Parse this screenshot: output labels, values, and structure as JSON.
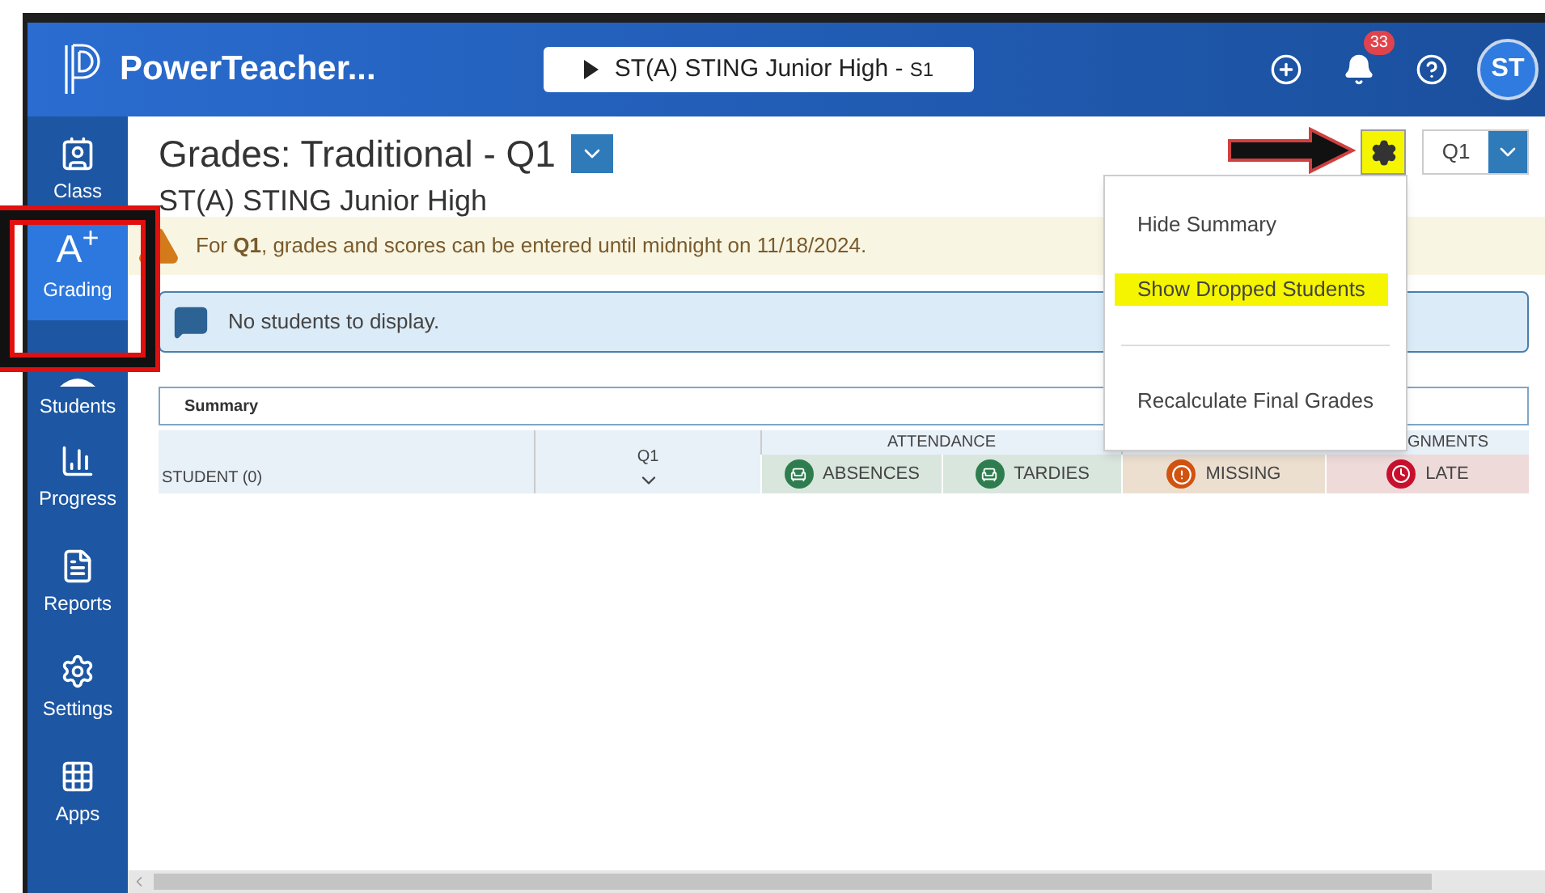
{
  "header": {
    "app_name": "PowerTeacher...",
    "class_selector": {
      "label": "ST(A) STING Junior High - ",
      "section": "S1"
    },
    "notification_count": "33",
    "avatar": "ST"
  },
  "sidebar": {
    "items": [
      {
        "label": "Class",
        "selected": false
      },
      {
        "label": "Grading",
        "selected": true,
        "glyph": "A$^{+}$"
      },
      {
        "label": "Students",
        "selected": false
      },
      {
        "label": "Progress",
        "selected": false
      },
      {
        "label": "Reports",
        "selected": false
      },
      {
        "label": "Settings",
        "selected": false
      },
      {
        "label": "Apps",
        "selected": false
      }
    ]
  },
  "page": {
    "title": "Grades: Traditional - Q1",
    "subtitle": "ST(A) STING Junior High",
    "settings_highlighted": true,
    "term_select": "Q1"
  },
  "settings_menu": {
    "open": true,
    "items": [
      {
        "label": "Hide Summary",
        "highlighted": false
      },
      {
        "label": "Show Dropped Students",
        "highlighted": true
      },
      {
        "kind": "divider"
      },
      {
        "label": "Recalculate Final Grades",
        "highlighted": false
      }
    ]
  },
  "warning": "For **Q1**, grades and scores can be entered until midnight on 11/18/2024.",
  "info": "No students to display.",
  "summary": {
    "label": "Summary"
  },
  "table": {
    "student_column": "STUDENT (0)",
    "term_column": "Q1",
    "groups": [
      {
        "label": "ATTENDANCE"
      },
      {
        "label": "GNMENTS"
      }
    ],
    "columns": [
      {
        "label": "ABSENCES",
        "kind": "attendance"
      },
      {
        "label": "TARDIES",
        "kind": "attendance"
      },
      {
        "label": "MISSING",
        "kind": "missing"
      },
      {
        "label": "LATE",
        "kind": "late"
      }
    ]
  },
  "annotations": {
    "highlight_box": true,
    "pointer_arrow": true
  }
}
